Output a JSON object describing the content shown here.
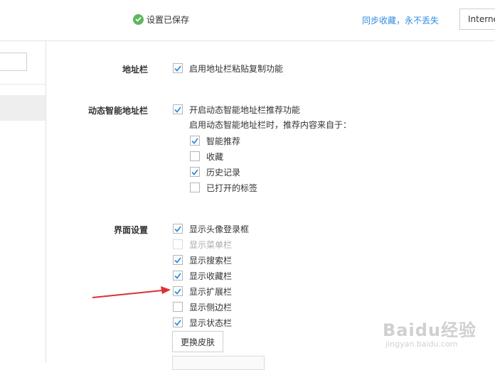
{
  "header": {
    "saved_status": "设置已保存",
    "sync_link": "同步收藏，永不丢失",
    "language_select": "Internet"
  },
  "sections": {
    "address_bar": {
      "label": "地址栏",
      "options": [
        {
          "label": "启用地址栏粘贴复制功能",
          "checked": true,
          "disabled": false
        }
      ]
    },
    "smart_address_bar": {
      "label": "动态智能地址栏",
      "options": [
        {
          "label": "开启动态智能地址栏推荐功能",
          "checked": true,
          "disabled": false
        }
      ],
      "hint": "启用动态智能地址栏时，推荐内容来自于：",
      "sub_options": [
        {
          "label": "智能推荐",
          "checked": true,
          "disabled": false
        },
        {
          "label": "收藏",
          "checked": false,
          "disabled": false
        },
        {
          "label": "历史记录",
          "checked": true,
          "disabled": false
        },
        {
          "label": "已打开的标签",
          "checked": false,
          "disabled": false
        }
      ]
    },
    "ui_settings": {
      "label": "界面设置",
      "options": [
        {
          "label": "显示头像登录框",
          "checked": true,
          "disabled": false
        },
        {
          "label": "显示菜单栏",
          "checked": false,
          "disabled": true
        },
        {
          "label": "显示搜索栏",
          "checked": true,
          "disabled": false
        },
        {
          "label": "显示收藏栏",
          "checked": true,
          "disabled": false
        },
        {
          "label": "显示扩展栏",
          "checked": true,
          "disabled": false
        },
        {
          "label": "显示侧边栏",
          "checked": false,
          "disabled": false
        },
        {
          "label": "显示状态栏",
          "checked": true,
          "disabled": false
        }
      ],
      "skin_button": "更换皮肤"
    }
  },
  "watermark": {
    "brand": "Baidu经验",
    "url": "jingyan.baidu.com"
  },
  "colors": {
    "accent": "#2f8ce0",
    "success": "#5cb85c",
    "arrow": "#e03030"
  }
}
